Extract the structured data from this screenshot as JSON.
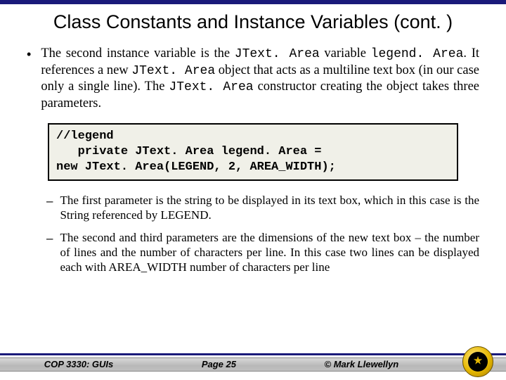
{
  "title": "Class Constants and Instance Variables (cont. )",
  "bullet": {
    "pre1": "The second instance variable is the ",
    "code1": "JText. Area",
    "mid1": " variable ",
    "code2": "legend. Area",
    "mid2": ". It references a new ",
    "code3": "JText. Area",
    "mid3": " object that acts as a multiline text box (in our case only a single line).  The ",
    "code4": "JText. Area",
    "post": " constructor creating the object takes three parameters."
  },
  "code_lines": {
    "l1": "//legend",
    "l2": "   private JText. Area legend. Area =",
    "l3": "new JText. Area(LEGEND, 2, AREA_WIDTH);"
  },
  "sub": {
    "s1": "The first parameter is the string to be displayed in its text box, which in this case is the String referenced by LEGEND.",
    "s2": "The second and third parameters are the dimensions of the new text box – the number of lines and the number of characters per line.  In this case two lines can be displayed each with AREA_WIDTH number of characters per line"
  },
  "footer": {
    "course": "COP 3330:  GUIs",
    "page": "Page 25",
    "copyright": "© Mark Llewellyn"
  }
}
